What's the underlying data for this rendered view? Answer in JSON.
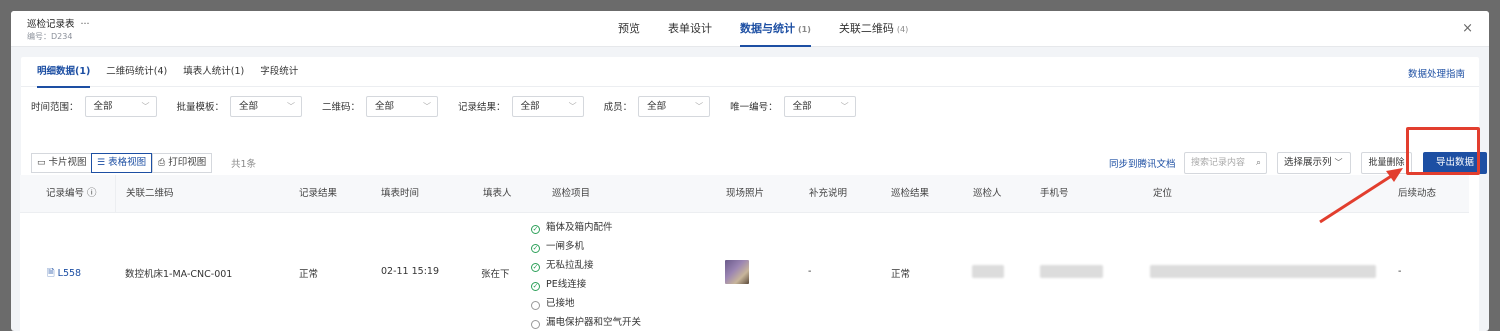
{
  "header": {
    "title": "巡检记录表",
    "more": "···",
    "code": "编号：D234",
    "tabs": [
      {
        "label": "预览",
        "count": ""
      },
      {
        "label": "表单设计",
        "count": ""
      },
      {
        "label": "数据与统计",
        "count": "(1)"
      },
      {
        "label": "关联二维码",
        "count": "(4)"
      }
    ],
    "close": "×"
  },
  "subtabs": [
    "明细数据(1)",
    "二维码统计(4)",
    "填表人统计(1)",
    "字段统计"
  ],
  "guide": "数据处理指南",
  "filters": [
    {
      "label": "时间范围：",
      "value": "全部"
    },
    {
      "label": "批量模板：",
      "value": "全部"
    },
    {
      "label": "二维码：",
      "value": "全部"
    },
    {
      "label": "记录结果：",
      "value": "全部"
    },
    {
      "label": "成员：",
      "value": "全部"
    },
    {
      "label": "唯一编号：",
      "value": "全部"
    }
  ],
  "toolbar": {
    "views": [
      "卡片视图",
      "表格视图",
      "打印视图"
    ],
    "total": "共1条",
    "sync": "同步到腾讯文档",
    "search_placeholder": "搜索记录内容",
    "column_select": "选择展示列",
    "batch_delete": "批量删除",
    "export": "导出数据"
  },
  "table": {
    "headers": [
      "记录编号",
      "关联二维码",
      "记录结果",
      "填表时间",
      "填表人",
      "巡检项目",
      "现场照片",
      "补充说明",
      "巡检结果",
      "巡检人",
      "手机号",
      "定位",
      "后续动态"
    ],
    "row": {
      "id": "L558",
      "qrcode": "数控机床1-MA-CNC-001",
      "result": "正常",
      "time": "02-11 15:19",
      "filler": "张在下",
      "items": [
        {
          "label": "箱体及箱内配件",
          "checked": true
        },
        {
          "label": "一闸多机",
          "checked": true
        },
        {
          "label": "无私拉乱接",
          "checked": true
        },
        {
          "label": "PE线连接",
          "checked": true
        },
        {
          "label": "已接地",
          "checked": false
        },
        {
          "label": "漏电保护器和空气开关",
          "checked": false
        }
      ],
      "note": "-",
      "check_result": "正常",
      "follow": "-"
    }
  },
  "colors": {
    "accent": "#1d4fa3",
    "highlight": "#e23e2e"
  }
}
